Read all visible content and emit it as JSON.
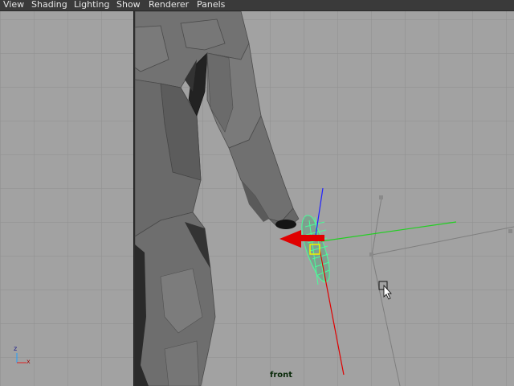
{
  "menu": {
    "items": [
      {
        "id": "view",
        "label": "View"
      },
      {
        "id": "shading",
        "label": "Shading"
      },
      {
        "id": "lighting",
        "label": "Lighting"
      },
      {
        "id": "show",
        "label": "Show"
      },
      {
        "id": "renderer",
        "label": "Renderer"
      },
      {
        "id": "panels",
        "label": "Panels"
      }
    ]
  },
  "viewport": {
    "camera_label": "front",
    "axis_indicator": {
      "x_label": "x",
      "z_label": "z"
    },
    "colors": {
      "background": "#a2a2a2",
      "grid_line": "#8e8e8e",
      "axis_line": "#1c1c1c",
      "mesh_face": "#6a6a6a",
      "mesh_dark": "#353535",
      "selection_wire": "#49ff9a",
      "manip_x": "#e00000",
      "manip_y": "#20d020",
      "manip_z": "#2020ff"
    },
    "icons": [
      "mouse-cursor-icon",
      "move-manipulator-icon"
    ]
  }
}
